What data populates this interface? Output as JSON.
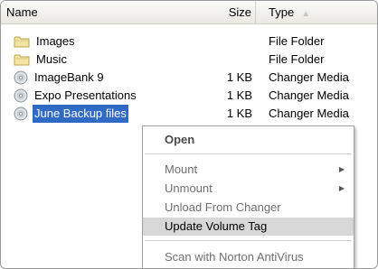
{
  "header": {
    "name": "Name",
    "size": "Size",
    "type": "Type",
    "sort_indicator": "▲"
  },
  "files": [
    {
      "name": "Images",
      "size": "",
      "type": "File Folder",
      "icon": "folder-icon"
    },
    {
      "name": "Music",
      "size": "",
      "type": "File Folder",
      "icon": "folder-icon"
    },
    {
      "name": "ImageBank 9",
      "size": "1 KB",
      "type": "Changer Media",
      "icon": "disc-icon"
    },
    {
      "name": "Expo Presentations",
      "size": "1 KB",
      "type": "Changer Media",
      "icon": "disc-icon"
    },
    {
      "name": "June Backup files",
      "size": "1 KB",
      "type": "Changer Media",
      "icon": "disc-icon",
      "selected": true
    }
  ],
  "context_menu": {
    "open": "Open",
    "mount": "Mount",
    "unmount": "Unmount",
    "unload": "Unload From Changer",
    "update_tag": "Update Volume Tag",
    "scan": "Scan with Norton AntiVirus",
    "submenu_arrow": "▶"
  },
  "colors": {
    "selection": "#316ac5",
    "menu_highlight": "#d7d7d7"
  }
}
